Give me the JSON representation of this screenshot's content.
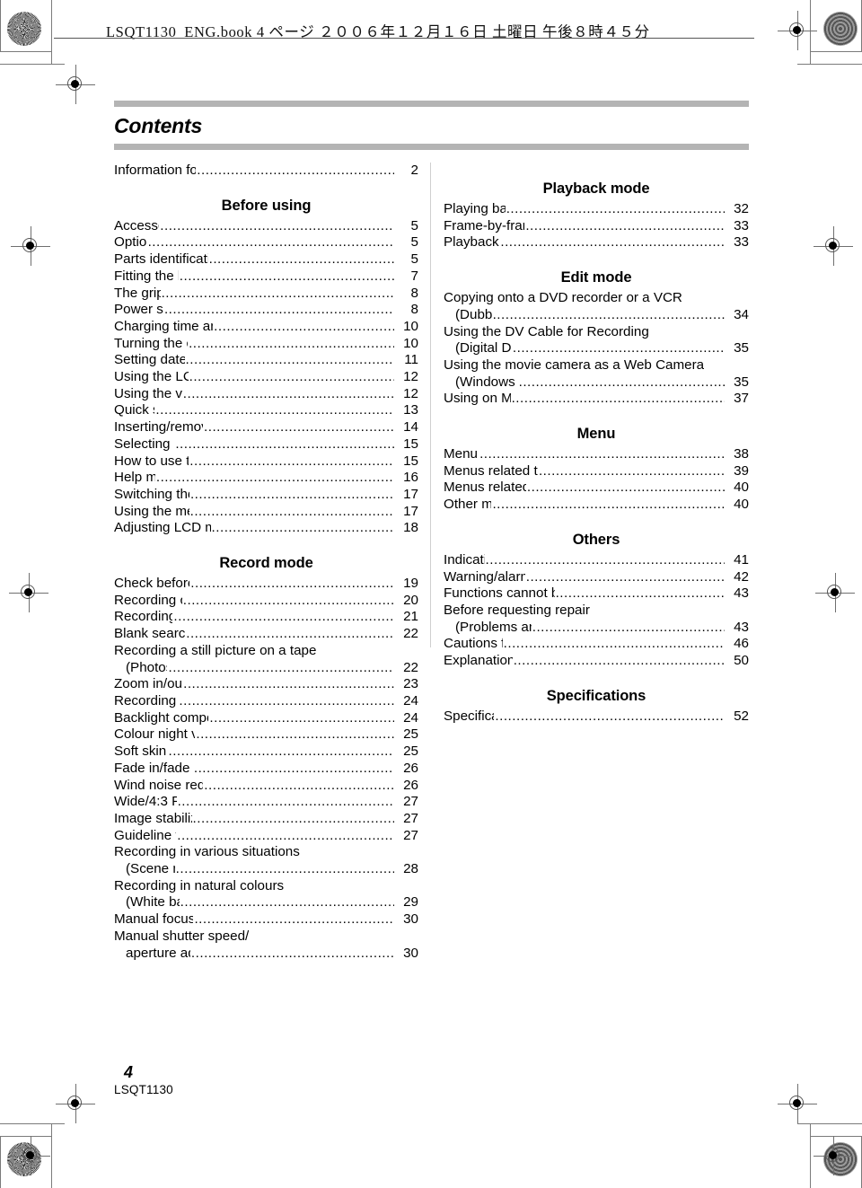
{
  "header": {
    "text": "LSQT1130_ENG.book   4 ページ   ２００６年１２月１６日   土曜日   午後８時４５分"
  },
  "document": {
    "title": "Contents"
  },
  "footer": {
    "page_number": "4",
    "doc_code": "LSQT1130"
  },
  "colors": {
    "rule_bar": "#b4b4b4",
    "text": "#000000",
    "divider": "#cfcfcf",
    "mark": "#7b7b7b"
  },
  "toc": {
    "left_column": [
      {
        "heading": null,
        "entries": [
          {
            "label": "Information for your safety",
            "page": "2",
            "continuation": false
          }
        ]
      },
      {
        "heading": "Before using",
        "entries": [
          {
            "label": "Accessories",
            "page": "5",
            "continuation": false
          },
          {
            "label": "Optional",
            "page": "5",
            "continuation": false
          },
          {
            "label": "Parts identification and handling",
            "page": "5",
            "continuation": false
          },
          {
            "label": "Fitting the lens cap",
            "page": "7",
            "continuation": false
          },
          {
            "label": "The grip belt",
            "page": "8",
            "continuation": false
          },
          {
            "label": "Power supply",
            "page": "8",
            "continuation": false
          },
          {
            "label": "Charging time and recordable time",
            "page": "10",
            "continuation": false
          },
          {
            "label": "Turning the camera on",
            "page": "10",
            "continuation": false
          },
          {
            "label": "Setting date and time",
            "page": "11",
            "continuation": false
          },
          {
            "label": "Using the LCD monitor",
            "page": "12",
            "continuation": false
          },
          {
            "label": "Using the viewfinder",
            "page": "12",
            "continuation": false
          },
          {
            "label": "Quick start",
            "page": "13",
            "continuation": false
          },
          {
            "label": "Inserting/removing a cassette",
            "page": "14",
            "continuation": false
          },
          {
            "label": "Selecting a mode",
            "page": "15",
            "continuation": false
          },
          {
            "label": "How to use the joystick",
            "page": "15",
            "continuation": false
          },
          {
            "label": "Help mode",
            "page": "16",
            "continuation": false
          },
          {
            "label": "Switching the language",
            "page": "17",
            "continuation": false
          },
          {
            "label": "Using the menu screen",
            "page": "17",
            "continuation": false
          },
          {
            "label": "Adjusting LCD monitor/viewfinder",
            "page": "18",
            "continuation": false
          }
        ]
      },
      {
        "heading": "Record mode",
        "entries": [
          {
            "label": "Check before recording",
            "page": "19",
            "continuation": false
          },
          {
            "label": "Recording on a tape",
            "page": "20",
            "continuation": false
          },
          {
            "label": "Recording check",
            "page": "21",
            "continuation": false
          },
          {
            "label": "Blank search function",
            "page": "22",
            "continuation": false
          },
          {
            "label": "Recording a still picture on a tape",
            "page": null,
            "continuation": false
          },
          {
            "label": "(Photoshot)",
            "page": "22",
            "continuation": true
          },
          {
            "label": "Zoom in/out function",
            "page": "23",
            "continuation": false
          },
          {
            "label": "Recording yourself",
            "page": "24",
            "continuation": false
          },
          {
            "label": "Backlight compensation function",
            "page": "24",
            "continuation": false
          },
          {
            "label": "Colour night view function",
            "page": "25",
            "continuation": false
          },
          {
            "label": "Soft skin mode",
            "page": "25",
            "continuation": false
          },
          {
            "label": "Fade in/fade out function",
            "page": "26",
            "continuation": false
          },
          {
            "label": "Wind noise reduction function",
            "page": "26",
            "continuation": false
          },
          {
            "label": "Wide/4:3 Function",
            "page": "27",
            "continuation": false
          },
          {
            "label": "Image stabilizer function",
            "page": "27",
            "continuation": false
          },
          {
            "label": "Guideline function",
            "page": "27",
            "continuation": false
          },
          {
            "label": "Recording in various situations",
            "page": null,
            "continuation": false
          },
          {
            "label": "(Scene mode)",
            "page": "28",
            "continuation": true
          },
          {
            "label": "Recording in natural colours",
            "page": null,
            "continuation": false
          },
          {
            "label": "(White balance)",
            "page": "29",
            "continuation": true
          },
          {
            "label": "Manual focus adjustment",
            "page": "30",
            "continuation": false
          },
          {
            "label": "Manual shutter speed/",
            "page": null,
            "continuation": false
          },
          {
            "label": "aperture adjustment",
            "page": "30",
            "continuation": true
          }
        ]
      }
    ],
    "right_column": [
      {
        "heading": "Playback mode",
        "entries": [
          {
            "label": "Playing back tape",
            "page": "32",
            "continuation": false
          },
          {
            "label": "Frame-by-frame playback",
            "page": "33",
            "continuation": false
          },
          {
            "label": "Playback on TV",
            "page": "33",
            "continuation": false
          }
        ]
      },
      {
        "heading": "Edit mode",
        "entries": [
          {
            "label": "Copying onto a DVD recorder or a VCR",
            "page": null,
            "continuation": false
          },
          {
            "label": "(Dubbing)",
            "page": "34",
            "continuation": true
          },
          {
            "label": "Using the DV Cable for Recording",
            "page": null,
            "continuation": false
          },
          {
            "label": "(Digital Dubbing)",
            "page": "35",
            "continuation": true
          },
          {
            "label": "Using the movie camera as a Web Camera",
            "page": null,
            "continuation": false
          },
          {
            "label": "(Windows XP SP2)",
            "page": "35",
            "continuation": true
          },
          {
            "label": "Using on Macintosh",
            "page": "37",
            "continuation": false
          }
        ]
      },
      {
        "heading": "Menu",
        "entries": [
          {
            "label": "Menu list",
            "page": "38",
            "continuation": false
          },
          {
            "label": "Menus related to taking pictures",
            "page": "39",
            "continuation": false
          },
          {
            "label": "Menus related to playback",
            "page": "40",
            "continuation": false
          },
          {
            "label": "Other menus",
            "page": "40",
            "continuation": false
          }
        ]
      },
      {
        "heading": "Others",
        "entries": [
          {
            "label": "Indications",
            "page": "41",
            "continuation": false
          },
          {
            "label": "Warning/alarm indications",
            "page": "42",
            "continuation": false
          },
          {
            "label": "Functions cannot be used simultaneously",
            "page": "43",
            "continuation": false
          },
          {
            "label": "Before requesting repair",
            "page": null,
            "continuation": false
          },
          {
            "label": "(Problems and solutions)",
            "page": "43",
            "continuation": true
          },
          {
            "label": "Cautions for Use",
            "page": "46",
            "continuation": false
          },
          {
            "label": "Explanation of terms",
            "page": "50",
            "continuation": false
          }
        ]
      },
      {
        "heading": "Specifications",
        "entries": [
          {
            "label": "Specifications",
            "page": "52",
            "continuation": false
          }
        ]
      }
    ]
  }
}
